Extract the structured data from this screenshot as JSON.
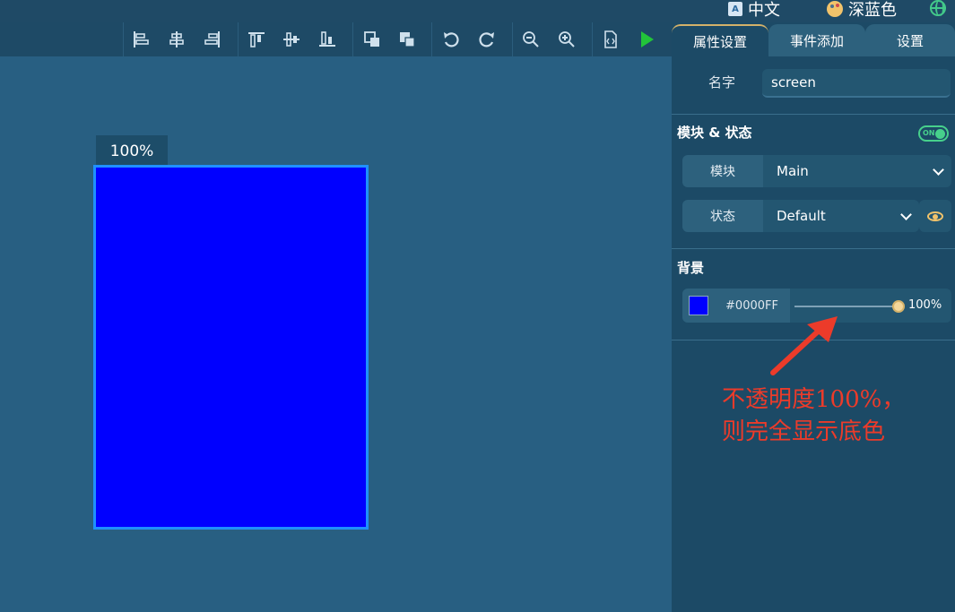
{
  "topbar": {
    "language_label": "中文",
    "language_icon_text": "A",
    "theme_label": "深蓝色"
  },
  "toolbar": {
    "tools": [
      {
        "name": "align-left-icon"
      },
      {
        "name": "align-center-h-icon"
      },
      {
        "name": "align-right-icon"
      },
      {
        "name": "align-top-icon"
      },
      {
        "name": "align-middle-v-icon"
      },
      {
        "name": "align-bottom-icon"
      },
      {
        "name": "bring-forward-icon"
      },
      {
        "name": "send-backward-icon"
      },
      {
        "name": "undo-icon"
      },
      {
        "name": "redo-icon"
      },
      {
        "name": "zoom-out-icon"
      },
      {
        "name": "zoom-in-icon"
      },
      {
        "name": "code-file-icon"
      },
      {
        "name": "play-icon"
      }
    ]
  },
  "canvas": {
    "zoom_label": "100%",
    "screen_color": "#0000FF",
    "screen_border_color": "#1F90FF"
  },
  "panel": {
    "tabs": [
      "属性设置",
      "事件添加",
      "设置"
    ],
    "active_tab": 0,
    "name_label": "名字",
    "name_value": "screen",
    "module_section_title": "模块 & 状态",
    "toggle_label": "ON",
    "toggle_on": true,
    "module_label": "模块",
    "module_value": "Main",
    "state_label": "状态",
    "state_value": "Default",
    "background_section_title": "背景",
    "bg_hex": "#0000FF",
    "bg_opacity": "100%"
  },
  "annotation": {
    "line1": "不透明度100%，",
    "line2": "则完全显示底色",
    "color": "#EC3B2A"
  }
}
